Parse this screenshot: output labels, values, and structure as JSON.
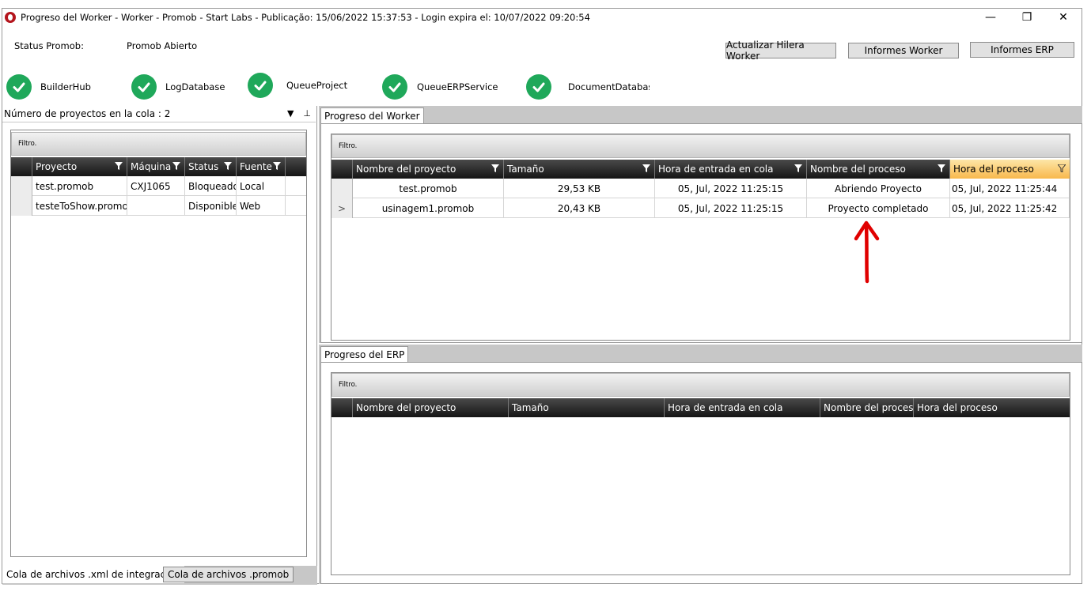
{
  "window": {
    "title": "Progreso del Worker  -  Worker - Promob  -  Start Labs  -  Publicação: 15/06/2022 15:37:53 - Login expira el: 10/07/2022 09:20:54",
    "controls": {
      "minimize": "—",
      "restore": "❐",
      "close": "✕"
    }
  },
  "status": {
    "label": "Status Promob:",
    "value": "Promob Abierto"
  },
  "buttons": {
    "update_queue": "Actualizar Hilera Worker",
    "worker_reports": "Informes Worker",
    "erp_reports": "Informes ERP"
  },
  "services": [
    {
      "name": "BuilderHub",
      "status": "ok"
    },
    {
      "name": "LogDatabase",
      "status": "ok"
    },
    {
      "name": "QueueProject",
      "status": "ok"
    },
    {
      "name": "QueueERPService",
      "status": "ok"
    },
    {
      "name": "DocumentDatabase",
      "status": "ok"
    }
  ],
  "left_panel": {
    "header": "Número de proyectos en la cola : 2",
    "dropdown_icon": "▼",
    "pin_icon": "⊥",
    "filter": "Filtro.",
    "columns": [
      "Proyecto",
      "Máquina",
      "Status",
      "Fuente"
    ],
    "rows": [
      {
        "proyecto": "test.promob",
        "maquina": "CXJ1065",
        "status": "Bloqueado",
        "fuente": "Local"
      },
      {
        "proyecto": "testeToShow.promob",
        "maquina": "",
        "status": "Disponible",
        "fuente": "Web"
      }
    ],
    "tabs": [
      "Cola de archivos .xml de integración",
      "Cola de archivos .promob"
    ]
  },
  "worker_panel": {
    "tab": "Progreso del Worker",
    "filter": "Filtro.",
    "columns": [
      "Nombre del proyecto",
      "Tamaño",
      "Hora de entrada en cola",
      "Nombre del proceso",
      "Hora del proceso"
    ],
    "rows": [
      {
        "indicator": "",
        "nombre": "test.promob",
        "tamano": "29,53 KB",
        "entrada": "05, Jul, 2022 11:25:15",
        "proceso": "Abriendo Proyecto",
        "hora": "05, Jul, 2022 11:25:44"
      },
      {
        "indicator": ">",
        "nombre": "usinagem1.promob",
        "tamano": "20,43 KB",
        "entrada": "05, Jul, 2022 11:25:15",
        "proceso": "Proyecto completado",
        "hora": "05, Jul, 2022 11:25:42"
      }
    ]
  },
  "erp_panel": {
    "tab": "Progreso del ERP",
    "filter": "Filtro.",
    "columns": [
      "Nombre del proyecto",
      "Tamaño",
      "Hora de entrada en cola",
      "Nombre del proceso",
      "Hora del proceso"
    ]
  },
  "colors": {
    "check_green": "#1fa85a",
    "annotation_red": "#e00000",
    "sorted_header": "#f8b84c"
  }
}
